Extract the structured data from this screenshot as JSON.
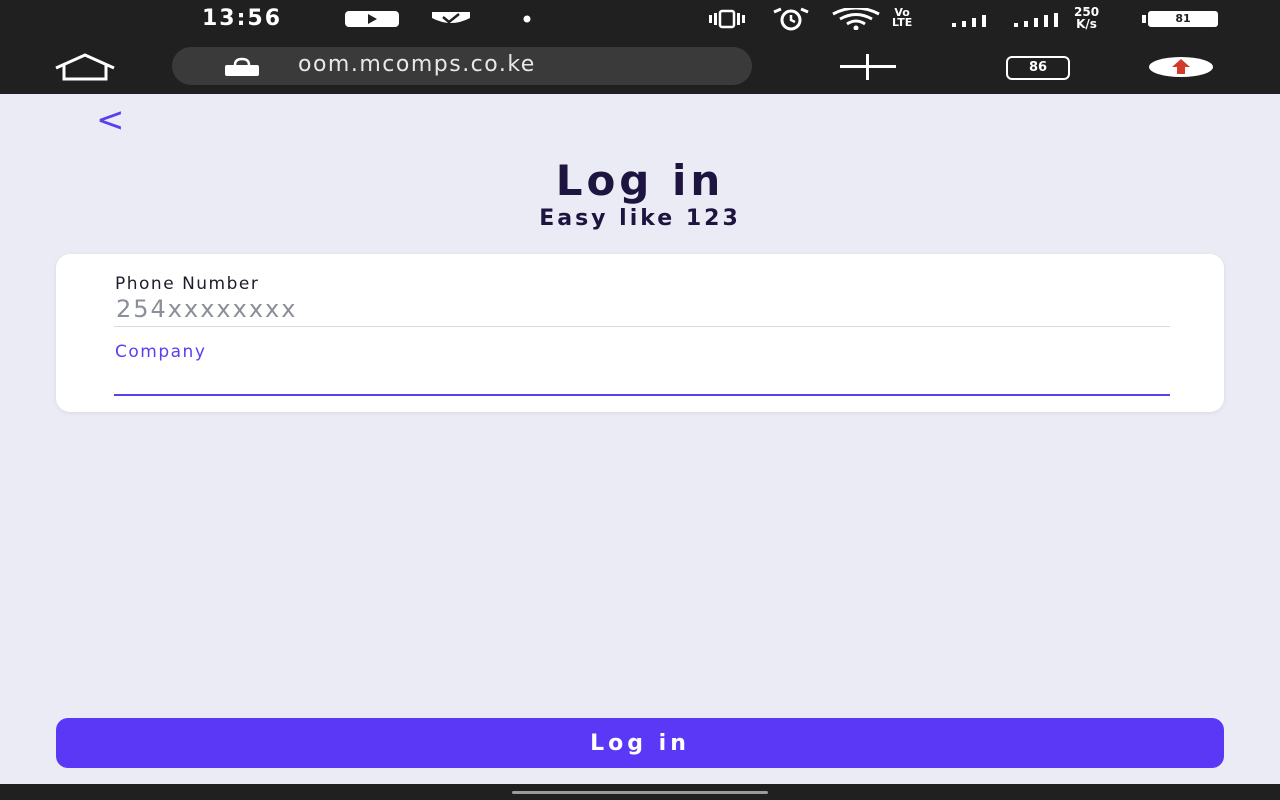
{
  "status_bar": {
    "time": "13:56",
    "network_label_top": "Vo",
    "network_label_bottom": "LTE",
    "speed_value": "250",
    "speed_unit": "K/s",
    "battery": "81",
    "icons": [
      "youtube-icon",
      "shield-icon",
      "dot-icon",
      "vibrate-icon",
      "alarm-icon",
      "wifi-icon",
      "signal-icon",
      "signal-icon-2",
      "battery-icon"
    ]
  },
  "browser": {
    "url": "oom.mcomps.co.ke",
    "tabs_count": "86",
    "icons": [
      "home-icon",
      "lock-icon",
      "plus-icon",
      "tabs-icon",
      "update-icon"
    ]
  },
  "page": {
    "back_glyph": "<",
    "title": "Log in",
    "subtitle": "Easy like 123",
    "phone_label": "Phone Number",
    "phone_placeholder": "254xxxxxxxx",
    "phone_value": "",
    "company_label": "Company",
    "company_value": "",
    "login_button": "Log in"
  },
  "colors": {
    "accent": "#5b38f6",
    "title": "#1d1440",
    "background": "#ebebf5",
    "bar": "#202020"
  }
}
